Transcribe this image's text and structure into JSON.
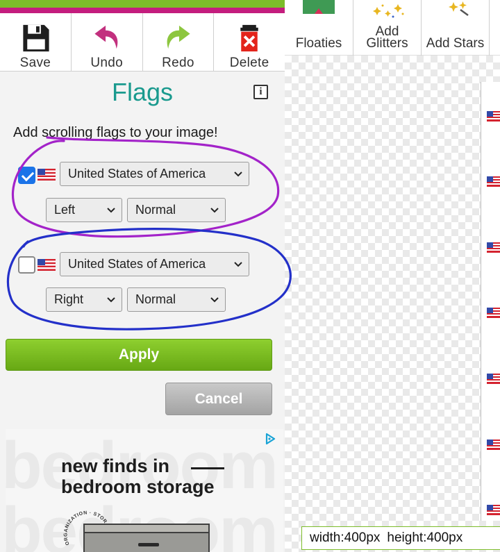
{
  "toolbar": {
    "save_label": "Save",
    "undo_label": "Undo",
    "redo_label": "Redo",
    "delete_label": "Delete"
  },
  "top_tabs": {
    "floaties_label": "Floaties",
    "glitters_label_line1": "Add",
    "glitters_label_line2": "Glitters",
    "stars_label": "Add Stars"
  },
  "panel": {
    "title": "Flags",
    "info_label": "i",
    "description": "Add scrolling flags to your image!"
  },
  "flag_rows": [
    {
      "checked": true,
      "country": "United States of America",
      "direction": "Left",
      "speed": "Normal"
    },
    {
      "checked": false,
      "country": "United States of America",
      "direction": "Right",
      "speed": "Normal"
    }
  ],
  "buttons": {
    "apply_label": "Apply",
    "cancel_label": "Cancel"
  },
  "ad": {
    "background_word": "bedroom",
    "headline_line1": "new finds in",
    "headline_line2": "bedroom storage",
    "seal_text": "ORGANIZATION · STORAGE ·",
    "icon": "adchoices-icon"
  },
  "canvas": {
    "width_text": "width:400px",
    "height_text": "height:400px",
    "flag_icon": "us-flag-icon",
    "flag_count": 7
  },
  "colors": {
    "accent_green": "#7cbc2a",
    "accent_magenta": "#c41d7e",
    "title_teal": "#1a9a8e",
    "annotation_purple": "#a323c9",
    "annotation_blue": "#2330c9"
  }
}
